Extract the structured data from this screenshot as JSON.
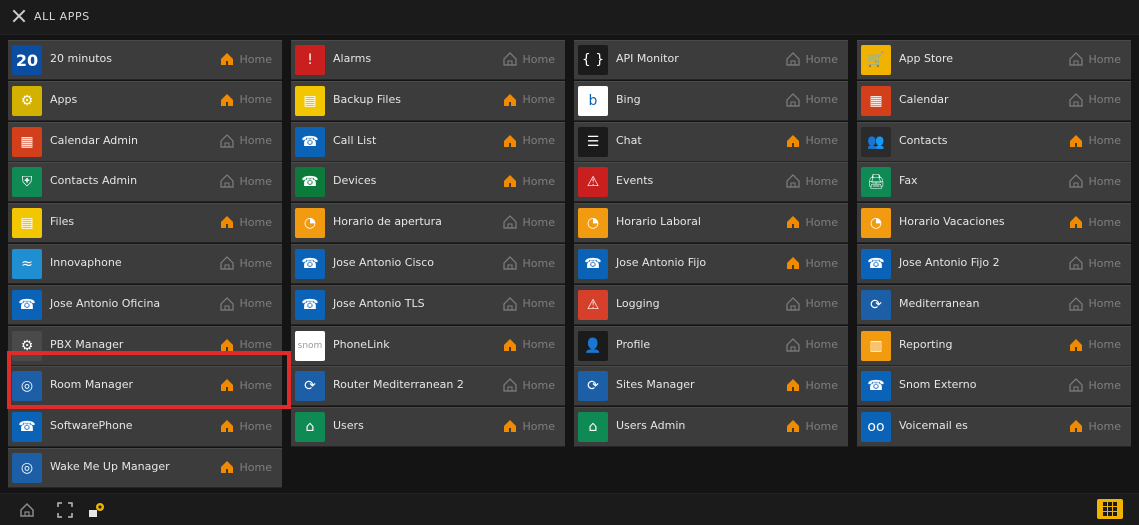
{
  "topbar": {
    "title": "ALL APPS"
  },
  "tiles": [
    {
      "name": "20 minutos",
      "home": "Home",
      "home_active": true,
      "icon": "20-minutos-icon",
      "icon_color": "#0b4da2",
      "icon_text": "20"
    },
    {
      "name": "Alarms",
      "home": "Home",
      "home_active": false,
      "icon": "alarm-icon",
      "icon_color": "#c91f1f",
      "icon_text": "!"
    },
    {
      "name": "API Monitor",
      "home": "Home",
      "home_active": false,
      "icon": "braces-icon",
      "icon_color": "#1b1b1b",
      "icon_text": "{ }"
    },
    {
      "name": "App Store",
      "home": "Home",
      "home_active": false,
      "icon": "cart-icon",
      "icon_color": "#f0b400",
      "icon_text": "🛒"
    },
    {
      "name": "Apps",
      "home": "Home",
      "home_active": true,
      "icon": "apps-icon",
      "icon_color": "#d4b000",
      "icon_text": "⚙"
    },
    {
      "name": "Backup Files",
      "home": "Home",
      "home_active": true,
      "icon": "backup-files-icon",
      "icon_color": "#f2c600",
      "icon_text": "▤"
    },
    {
      "name": "Bing",
      "home": "Home",
      "home_active": false,
      "icon": "bing-icon",
      "icon_color": "#ffffff",
      "icon_text": "b"
    },
    {
      "name": "Calendar",
      "home": "Home",
      "home_active": false,
      "icon": "calendar-icon",
      "icon_color": "#d33f1a",
      "icon_text": "▦"
    },
    {
      "name": "Calendar Admin",
      "home": "Home",
      "home_active": false,
      "icon": "calendar-admin-icon",
      "icon_color": "#d33f1a",
      "icon_text": "▦"
    },
    {
      "name": "Call List",
      "home": "Home",
      "home_active": true,
      "icon": "call-list-icon",
      "icon_color": "#0b63b7",
      "icon_text": "☎"
    },
    {
      "name": "Chat",
      "home": "Home",
      "home_active": true,
      "icon": "chat-icon",
      "icon_color": "#1b1b1b",
      "icon_text": "☰"
    },
    {
      "name": "Contacts",
      "home": "Home",
      "home_active": true,
      "icon": "contacts-icon",
      "icon_color": "#2b2b2b",
      "icon_text": "👥"
    },
    {
      "name": "Contacts Admin",
      "home": "Home",
      "home_active": false,
      "icon": "contacts-admin-icon",
      "icon_color": "#0f8a55",
      "icon_text": "⛨"
    },
    {
      "name": "Devices",
      "home": "Home",
      "home_active": true,
      "icon": "devices-icon",
      "icon_color": "#0c7a3b",
      "icon_text": "☎"
    },
    {
      "name": "Events",
      "home": "Home",
      "home_active": false,
      "icon": "events-icon",
      "icon_color": "#c91f1f",
      "icon_text": "⚠"
    },
    {
      "name": "Fax",
      "home": "Home",
      "home_active": false,
      "icon": "fax-icon",
      "icon_color": "#0f8a55",
      "icon_text": "🖨"
    },
    {
      "name": "Files",
      "home": "Home",
      "home_active": true,
      "icon": "files-icon",
      "icon_color": "#f2c600",
      "icon_text": "▤"
    },
    {
      "name": "Horario de apertura",
      "home": "Home",
      "home_active": false,
      "icon": "clock-icon",
      "icon_color": "#f29b10",
      "icon_text": "◔"
    },
    {
      "name": "Horario Laboral",
      "home": "Home",
      "home_active": true,
      "icon": "clock-icon",
      "icon_color": "#f29b10",
      "icon_text": "◔"
    },
    {
      "name": "Horario Vacaciones",
      "home": "Home",
      "home_active": true,
      "icon": "clock-icon",
      "icon_color": "#f29b10",
      "icon_text": "◔"
    },
    {
      "name": "Innovaphone",
      "home": "Home",
      "home_active": false,
      "icon": "innovaphone-icon",
      "icon_color": "#1f8fd1",
      "icon_text": "≈"
    },
    {
      "name": "Jose Antonio Cisco",
      "home": "Home",
      "home_active": false,
      "icon": "phone-keypad-icon",
      "icon_color": "#0b63b7",
      "icon_text": "☎"
    },
    {
      "name": "Jose Antonio Fijo",
      "home": "Home",
      "home_active": true,
      "icon": "phone-keypad-icon",
      "icon_color": "#0b63b7",
      "icon_text": "☎"
    },
    {
      "name": "Jose Antonio Fijo 2",
      "home": "Home",
      "home_active": false,
      "icon": "phone-keypad-icon",
      "icon_color": "#0b63b7",
      "icon_text": "☎"
    },
    {
      "name": "Jose Antonio Oficina",
      "home": "Home",
      "home_active": false,
      "icon": "phone-keypad-icon",
      "icon_color": "#0b63b7",
      "icon_text": "☎"
    },
    {
      "name": "Jose Antonio TLS",
      "home": "Home",
      "home_active": false,
      "icon": "phone-keypad-icon",
      "icon_color": "#0b63b7",
      "icon_text": "☎"
    },
    {
      "name": "Logging",
      "home": "Home",
      "home_active": false,
      "icon": "logging-icon",
      "icon_color": "#d63f2a",
      "icon_text": "⚠"
    },
    {
      "name": "Mediterranean",
      "home": "Home",
      "home_active": false,
      "icon": "mediterranean-icon",
      "icon_color": "#1d5fa6",
      "icon_text": "⟳"
    },
    {
      "name": "PBX Manager",
      "home": "Home",
      "home_active": true,
      "icon": "pbx-manager-icon",
      "icon_color": "#4a4a4a",
      "icon_text": "⚙"
    },
    {
      "name": "PhoneLink",
      "home": "Home",
      "home_active": true,
      "icon": "snom-icon",
      "icon_color": "#ffffff",
      "icon_text": "snom"
    },
    {
      "name": "Profile",
      "home": "Home",
      "home_active": false,
      "icon": "profile-icon",
      "icon_color": "#1b1b1b",
      "icon_text": "👤"
    },
    {
      "name": "Reporting",
      "home": "Home",
      "home_active": true,
      "icon": "reporting-icon",
      "icon_color": "#f29b10",
      "icon_text": "▥"
    },
    {
      "name": "Room Manager",
      "home": "Home",
      "home_active": true,
      "icon": "room-manager-icon",
      "icon_color": "#1d5fa6",
      "icon_text": "◎"
    },
    {
      "name": "Router Mediterranean 2",
      "home": "Home",
      "home_active": false,
      "icon": "router-icon",
      "icon_color": "#1d5fa6",
      "icon_text": "⟳"
    },
    {
      "name": "Sites Manager",
      "home": "Home",
      "home_active": true,
      "icon": "sites-manager-icon",
      "icon_color": "#1d5fa6",
      "icon_text": "⟳"
    },
    {
      "name": "Snom Externo",
      "home": "Home",
      "home_active": false,
      "icon": "phone-keypad-icon",
      "icon_color": "#0b63b7",
      "icon_text": "☎"
    },
    {
      "name": "SoftwarePhone",
      "home": "Home",
      "home_active": true,
      "icon": "softphone-icon",
      "icon_color": "#0b63b7",
      "icon_text": "☎"
    },
    {
      "name": "Users",
      "home": "Home",
      "home_active": true,
      "icon": "users-icon",
      "icon_color": "#0f8a55",
      "icon_text": "⌂"
    },
    {
      "name": "Users Admin",
      "home": "Home",
      "home_active": true,
      "icon": "users-admin-icon",
      "icon_color": "#0f8a55",
      "icon_text": "⌂"
    },
    {
      "name": "Voicemail es",
      "home": "Home",
      "home_active": true,
      "icon": "voicemail-icon",
      "icon_color": "#0b63b7",
      "icon_text": "oo"
    },
    {
      "name": "Wake Me Up Manager",
      "home": "Home",
      "home_active": true,
      "icon": "wake-me-up-icon",
      "icon_color": "#1d5fa6",
      "icon_text": "◎"
    }
  ],
  "bottombar": {
    "home_icon": "home-icon",
    "fullscreen_icon": "fullscreen-icon",
    "settings_icon": "settings-icon",
    "apps_grid_icon": "apps-grid-icon",
    "accent": "#f0b400"
  }
}
